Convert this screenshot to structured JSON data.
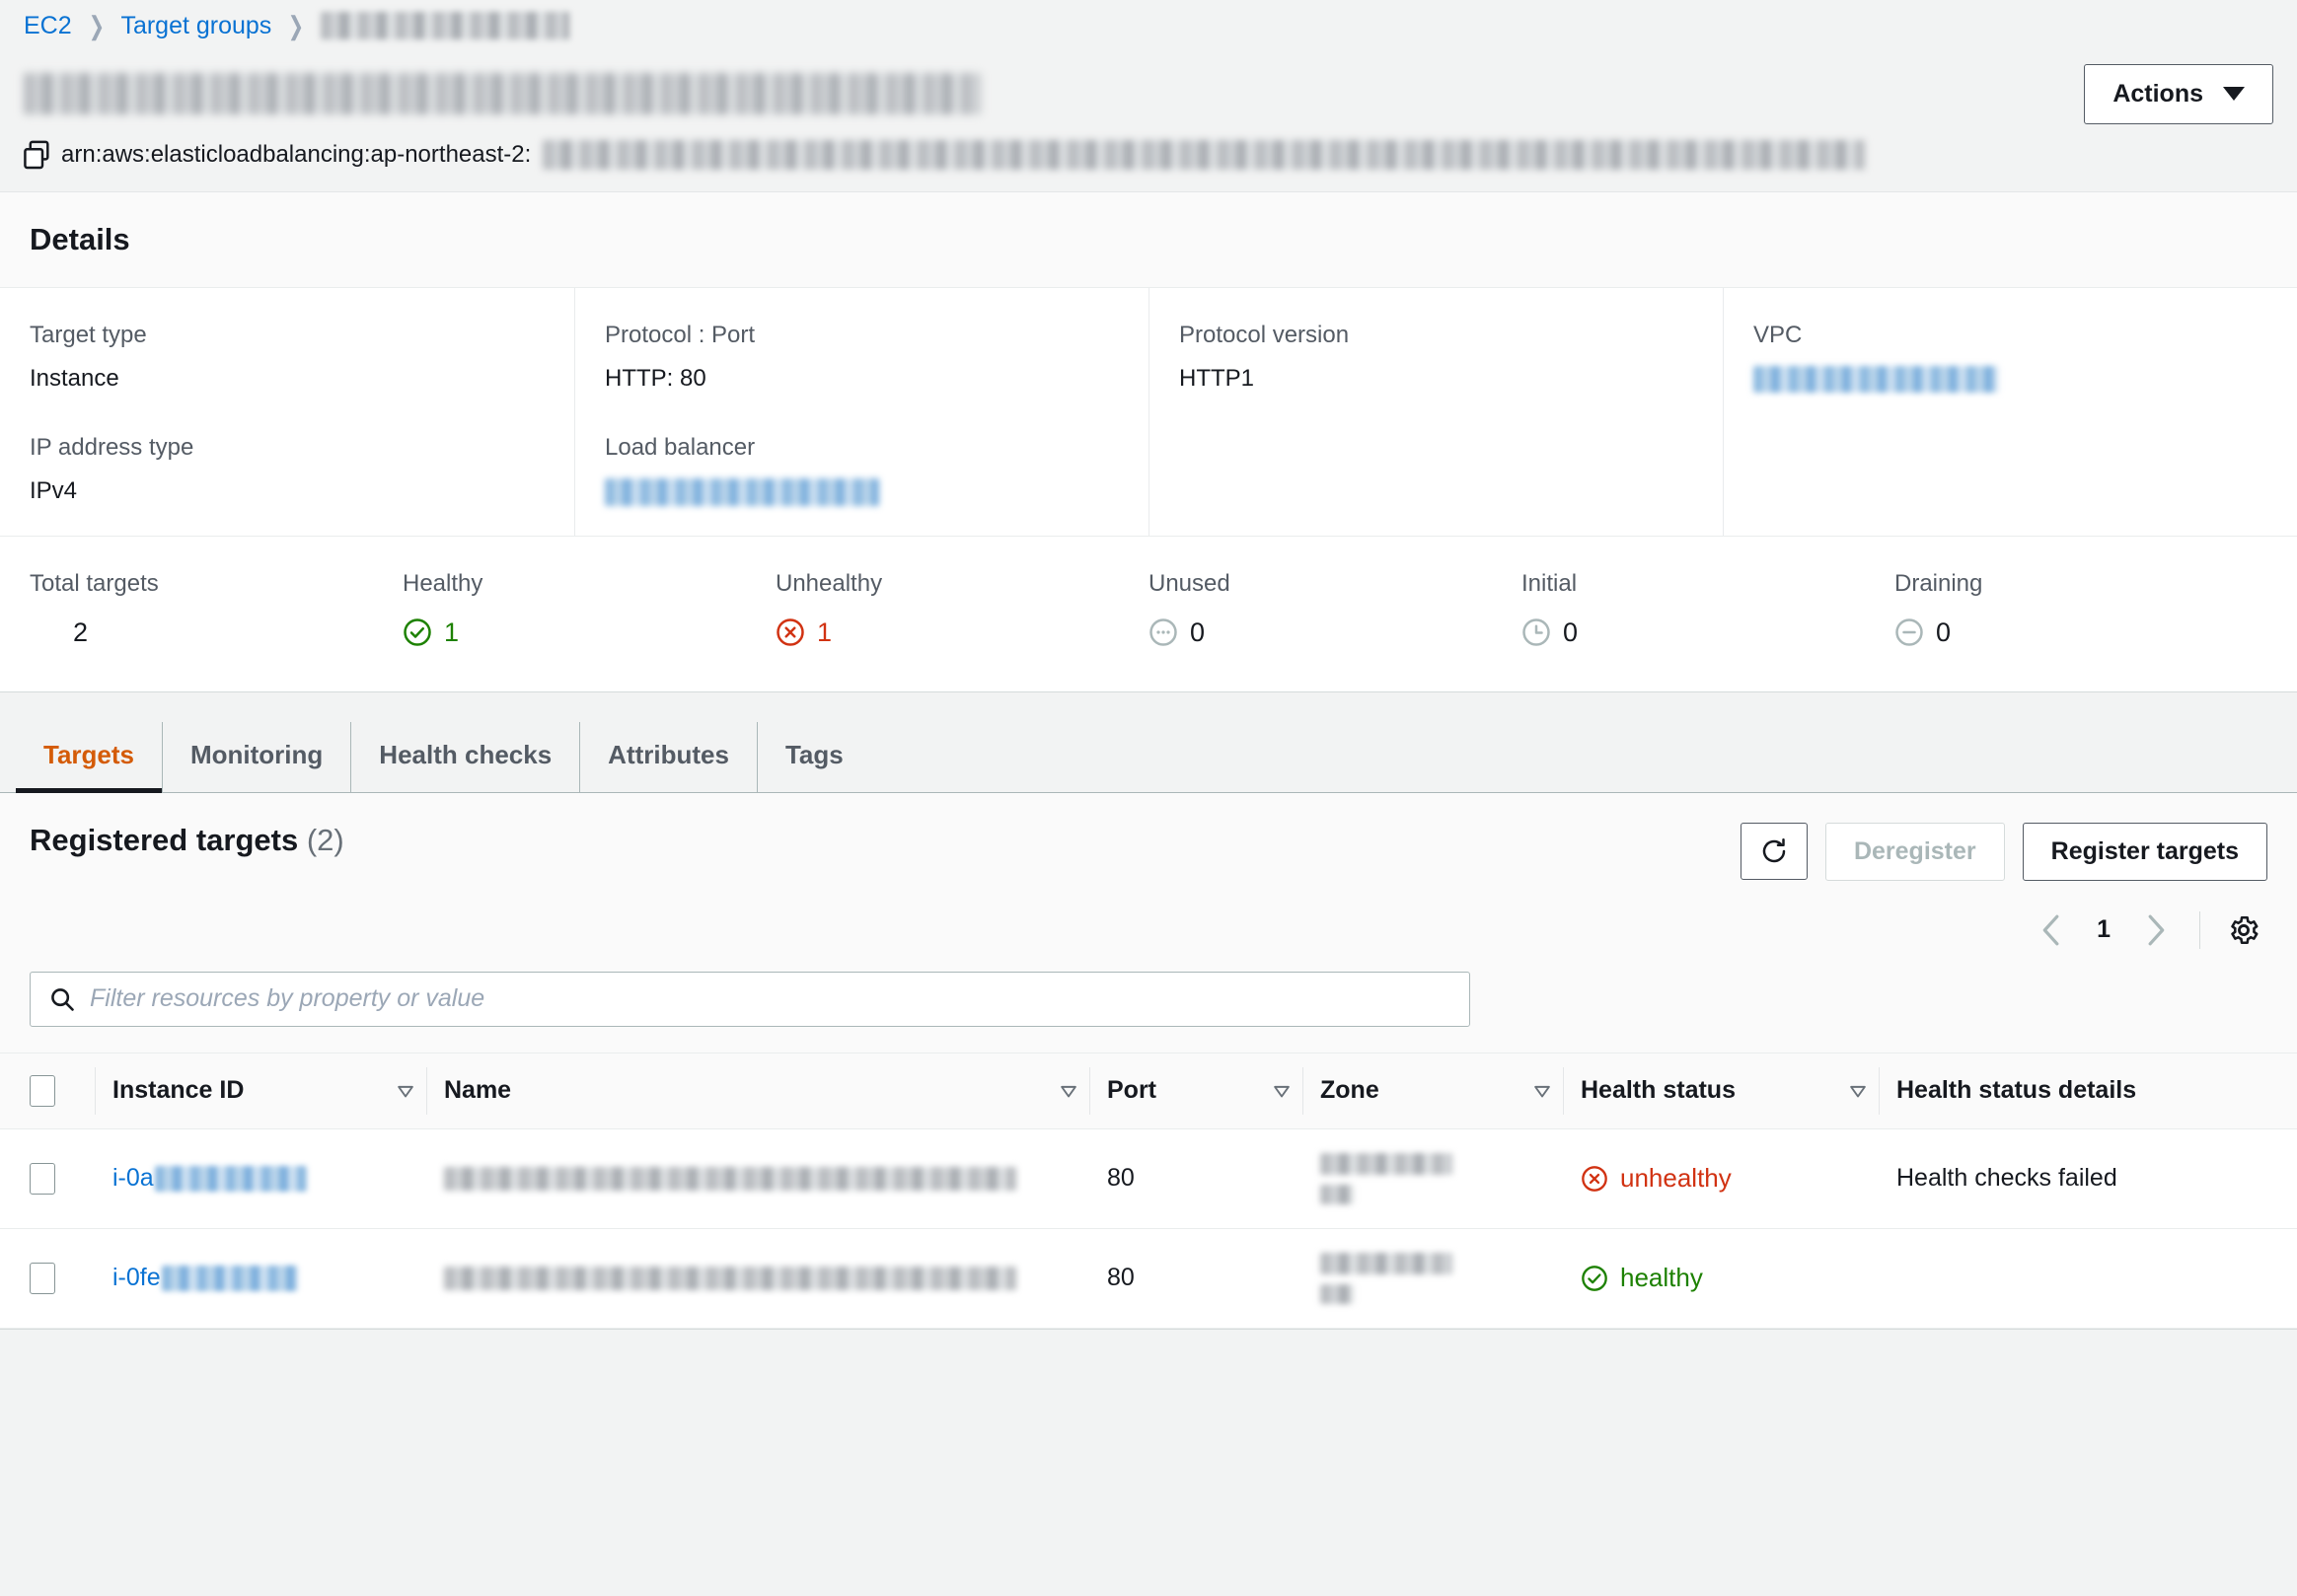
{
  "breadcrumb": {
    "items": [
      {
        "label": "EC2",
        "link": true
      },
      {
        "label": "Target groups",
        "link": true
      },
      {
        "label": "",
        "redacted": true
      }
    ]
  },
  "header": {
    "title_redacted": true,
    "actions_button": "Actions",
    "caret": "chevron-down-icon"
  },
  "arn": {
    "prefix": "arn:aws:elasticloadbalancing:ap-northeast-2:",
    "suffix_redacted": true,
    "copy_icon": "copy-icon"
  },
  "details": {
    "heading": "Details",
    "fields": [
      {
        "label": "Target type",
        "value": "Instance"
      },
      {
        "label": "Protocol : Port",
        "value": "HTTP: 80"
      },
      {
        "label": "Protocol version",
        "value": "HTTP1"
      },
      {
        "label": "VPC",
        "value": "",
        "redacted": true,
        "link": true
      },
      {
        "label": "IP address type",
        "value": "IPv4"
      },
      {
        "label": "Load balancer",
        "value": "",
        "redacted": true,
        "link": true
      }
    ],
    "stats": [
      {
        "label": "Total targets",
        "value": "2",
        "icon": "",
        "color": "default"
      },
      {
        "label": "Healthy",
        "value": "1",
        "icon": "check-circle-icon",
        "color": "#1d8102"
      },
      {
        "label": "Unhealthy",
        "value": "1",
        "icon": "error-circle-icon",
        "color": "#d13212"
      },
      {
        "label": "Unused",
        "value": "0",
        "icon": "ellipsis-circle-icon",
        "color": "#879596"
      },
      {
        "label": "Initial",
        "value": "0",
        "icon": "clock-circle-icon",
        "color": "#879596"
      },
      {
        "label": "Draining",
        "value": "0",
        "icon": "minus-circle-icon",
        "color": "#879596"
      }
    ]
  },
  "tabs": [
    {
      "label": "Targets",
      "active": true
    },
    {
      "label": "Monitoring",
      "active": false
    },
    {
      "label": "Health checks",
      "active": false
    },
    {
      "label": "Attributes",
      "active": false
    },
    {
      "label": "Tags",
      "active": false
    }
  ],
  "registered": {
    "title": "Registered targets",
    "count": "(2)",
    "refresh_icon": "refresh-icon",
    "deregister_label": "Deregister",
    "deregister_disabled": true,
    "register_label": "Register targets",
    "pagination": {
      "prev_icon": "chevron-left-icon",
      "page": "1",
      "next_icon": "chevron-right-icon",
      "settings_icon": "gear-icon"
    },
    "search": {
      "icon": "search-icon",
      "placeholder": "Filter resources by property or value",
      "value": ""
    },
    "columns": [
      {
        "label": "Instance ID",
        "sortable": true
      },
      {
        "label": "Name",
        "sortable": true
      },
      {
        "label": "Port",
        "sortable": true
      },
      {
        "label": "Zone",
        "sortable": true
      },
      {
        "label": "Health status",
        "sortable": true
      },
      {
        "label": "Health status details",
        "sortable": false
      }
    ],
    "rows": [
      {
        "instance_id_prefix": "i-0a",
        "instance_id_redacted": true,
        "name_redacted": true,
        "port": "80",
        "zone_redacted": true,
        "health_status": "unhealthy",
        "health_icon": "error-circle-icon",
        "health_color": "#d13212",
        "health_status_details": "Health checks failed"
      },
      {
        "instance_id_prefix": "i-0fe",
        "instance_id_redacted": true,
        "name_redacted": true,
        "port": "80",
        "zone_redacted": true,
        "health_status": "healthy",
        "health_icon": "check-circle-icon",
        "health_color": "#1d8102",
        "health_status_details": ""
      }
    ]
  },
  "colors": {
    "link": "#0972d3",
    "accent_tab": "#d45b07",
    "healthy": "#1d8102",
    "unhealthy": "#d13212",
    "page_bg": "#f2f3f3"
  }
}
